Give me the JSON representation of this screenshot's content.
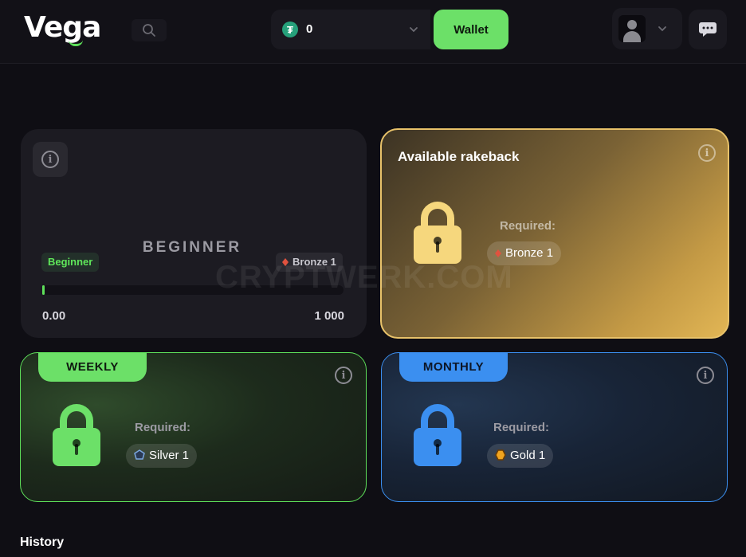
{
  "header": {
    "logo": "Vega",
    "balance": "0",
    "currency_icon": "tether-icon",
    "wallet_label": "Wallet"
  },
  "level_card": {
    "title": "BEGINNER",
    "current_badge": "Beginner",
    "next_rank": "Bronze 1",
    "progress_min": "0.00",
    "progress_max": "1 000",
    "progress_fraction": 0.0
  },
  "rakeback_card": {
    "title": "Available rakeback",
    "required_label": "Required:",
    "required_rank": "Bronze 1"
  },
  "weekly_card": {
    "tab": "WEEKLY",
    "required_label": "Required:",
    "required_rank": "Silver 1"
  },
  "monthly_card": {
    "tab": "MONTHLY",
    "required_label": "Required:",
    "required_rank": "Gold 1"
  },
  "history_title": "History",
  "watermark": "CRYPTWERK.COM",
  "colors": {
    "accent_green": "#5ee05a",
    "accent_blue": "#3b8ff0",
    "gold": "#e8c26a"
  }
}
